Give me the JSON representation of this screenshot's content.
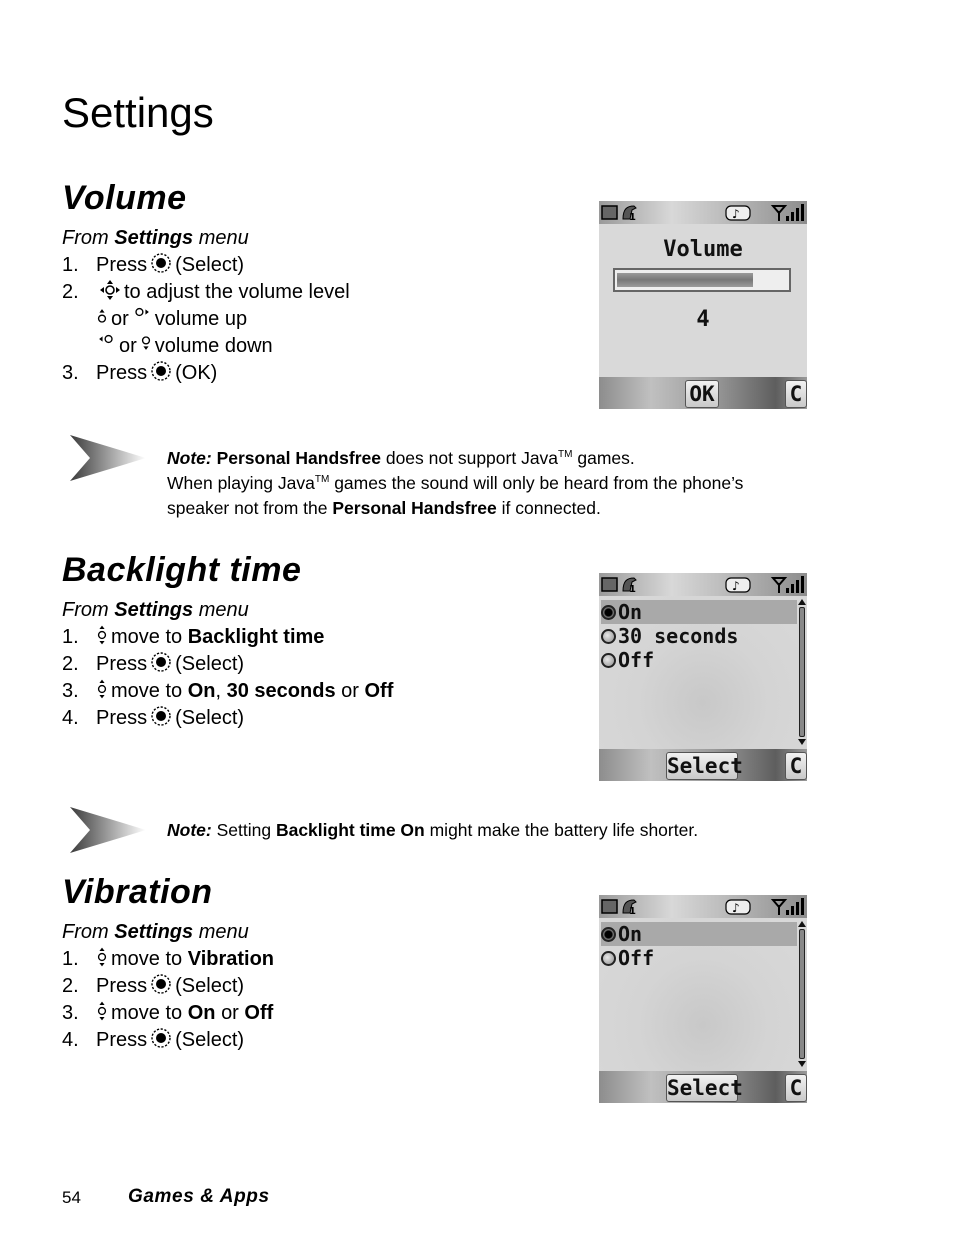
{
  "page": {
    "title": "Settings",
    "footer": {
      "page_number": "54",
      "chapter": "Games & Apps"
    }
  },
  "sections": {
    "volume": {
      "title": "Volume",
      "from": {
        "prefix": "From",
        "menu": "Settings",
        "suffix": "menu"
      },
      "steps": [
        {
          "num": "1.",
          "text_a": "Press",
          "icon": "select-key-icon",
          "text_b": "(Select)"
        },
        {
          "num": "2.",
          "icon": "navigation-key-icon",
          "text_b": "to adjust the volume level"
        },
        {
          "icon_a": "nav-up-icon",
          "or": "or",
          "icon_b": "nav-right-icon",
          "text": "volume up"
        },
        {
          "icon_a": "nav-left-icon",
          "or": "or",
          "icon_b": "nav-down-icon",
          "text": "volume down"
        },
        {
          "num": "3.",
          "text_a": "Press",
          "icon": "select-key-icon",
          "text_b": "(OK)"
        }
      ],
      "screen": {
        "heading": "Volume",
        "level": "4",
        "level_fraction": 0.8,
        "softkeys": {
          "left": "OK",
          "right": "C"
        }
      },
      "note": {
        "label": "Note:",
        "line1_bold": "Personal Handsfree",
        "line1_text": "does not support Java",
        "tm": "TM",
        "line1_end": "games.",
        "line2_a": "When playing Java",
        "line2_b": "games the sound will only be heard from the phone’s",
        "line3_a": "speaker not from the",
        "line3_bold": "Personal Handsfree",
        "line3_b": "if connected."
      }
    },
    "backlight": {
      "title": "Backlight time",
      "from": {
        "prefix": "From",
        "menu": "Settings",
        "suffix": "menu"
      },
      "steps": [
        {
          "num": "1.",
          "icon": "nav-up-down-icon",
          "text": "move to",
          "bold": "Backlight time"
        },
        {
          "num": "2.",
          "text_a": "Press",
          "icon": "select-key-icon",
          "text_b": "(Select)"
        },
        {
          "num": "3.",
          "icon": "nav-up-down-icon",
          "text": "move to",
          "bold_a": "On",
          "sep": ",",
          "bold_b": "30 seconds",
          "or": "or",
          "bold_c": "Off"
        },
        {
          "num": "4.",
          "text_a": "Press",
          "icon": "select-key-icon",
          "text_b": "(Select)"
        }
      ],
      "screen": {
        "options": [
          {
            "label": "On",
            "selected": true
          },
          {
            "label": "30 seconds",
            "selected": false
          },
          {
            "label": "Off",
            "selected": false
          }
        ],
        "softkeys": {
          "left": "Select",
          "right": "C"
        }
      },
      "note": {
        "label": "Note:",
        "text_a": "Setting",
        "bold": "Backlight time On",
        "text_b": "might make the battery life shorter."
      }
    },
    "vibration": {
      "title": "Vibration",
      "from": {
        "prefix": "From",
        "menu": "Settings",
        "suffix": "menu"
      },
      "steps": [
        {
          "num": "1.",
          "icon": "nav-up-down-icon",
          "text": "move to",
          "bold": "Vibration"
        },
        {
          "num": "2.",
          "text_a": "Press",
          "icon": "select-key-icon",
          "text_b": "(Select)"
        },
        {
          "num": "3.",
          "icon": "nav-up-down-icon",
          "text": "move to",
          "bold_a": "On",
          "or": "or",
          "bold_b": "Off"
        },
        {
          "num": "4.",
          "text_a": "Press",
          "icon": "select-key-icon",
          "text_b": "(Select)"
        }
      ],
      "screen": {
        "options": [
          {
            "label": "On",
            "selected": true
          },
          {
            "label": "Off",
            "selected": false
          }
        ],
        "softkeys": {
          "left": "Select",
          "right": "C"
        }
      }
    }
  },
  "status_icons": [
    "battery-icon",
    "line-1-icon",
    "ringtone-vibrate-icon",
    "signal-strength-icon"
  ]
}
